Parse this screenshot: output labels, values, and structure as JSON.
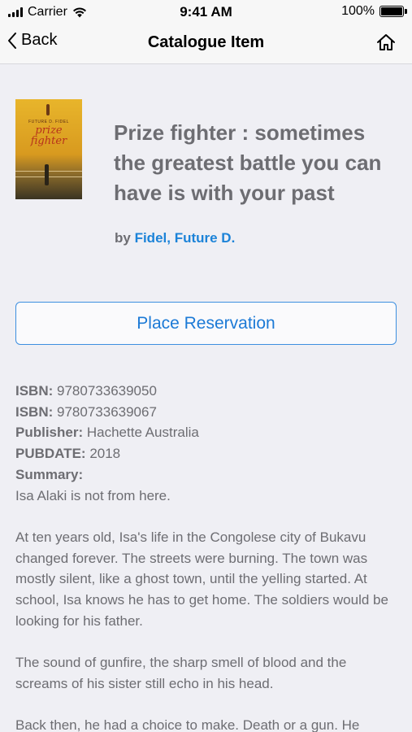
{
  "status_bar": {
    "carrier": "Carrier",
    "time": "9:41 AM",
    "battery": "100%",
    "battery_level": 1.0
  },
  "nav": {
    "back_label": "Back",
    "title": "Catalogue Item",
    "back_icon": "chevron-left-icon",
    "home_icon": "home-icon"
  },
  "book": {
    "cover_author": "FUTURE D. FIDEL",
    "cover_title_line1": "prize",
    "cover_title_line2": "fighter",
    "title": "Prize fighter : sometimes the greatest battle you can have is with your past",
    "by_label": "by",
    "author": "Fidel, Future D."
  },
  "actions": {
    "reserve_label": "Place Reservation"
  },
  "details": {
    "isbn_label": "ISBN:",
    "isbn1": "9780733639050",
    "isbn2": "9780733639067",
    "publisher_label": "Publisher:",
    "publisher": "Hachette Australia",
    "pubdate_label": "PUBDATE:",
    "pubdate": "2018",
    "summary_label": "Summary:",
    "summary": [
      "Isa Alaki is not from here.",
      "At ten years old, Isa's life in the Congolese city of Bukavu changed forever. The streets were burning. The town was mostly silent, like a ghost town, until the yelling started. At school, Isa knows he has to get home. The soldiers would be looking for his father.",
      "The sound of gunfire, the sharp smell of blood and the screams of his sister still echo in his head.",
      "Back then, he had a choice to make. Death or a gun. He"
    ]
  },
  "colors": {
    "accent": "#1c83d8",
    "text_gray": "#6d6d72",
    "background": "#efeff4",
    "bar": "#f7f7f7"
  }
}
